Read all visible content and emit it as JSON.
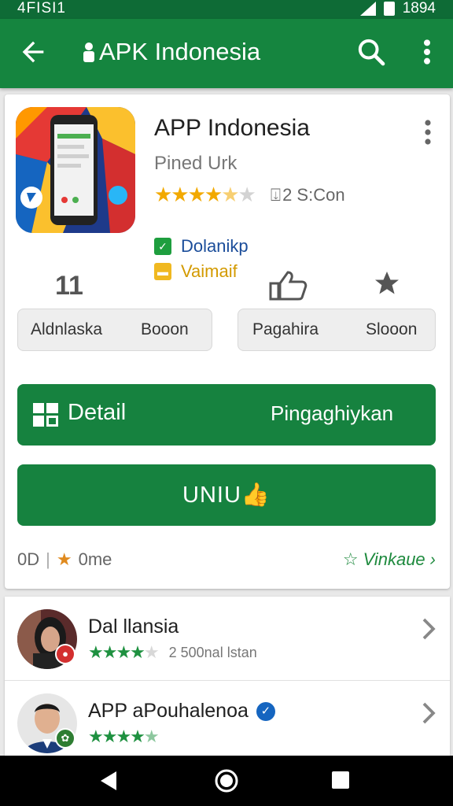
{
  "status_bar": {
    "left_text": "4FISI1",
    "time": "1894"
  },
  "app_bar": {
    "title": "APK Indonesia"
  },
  "app": {
    "name": "APP Indonesia",
    "developer": "Pined Urk",
    "rating": 4.5,
    "reviews": "2 S:Con",
    "badges": [
      {
        "label": "Dolanikp",
        "color": "#1b4d9a"
      },
      {
        "label": "Vaimaif",
        "color": "#d39a00"
      }
    ],
    "stat_left_icon_text": "11",
    "stat_left": {
      "label": "Aldnlaska",
      "value": "Booon"
    },
    "stat_right": {
      "label": "Pagahira",
      "value": "Slooon"
    }
  },
  "buttons": {
    "detail_label": "Detail",
    "detail_secondary": "Pingaghiykan",
    "install_label": "UNIU"
  },
  "footer": {
    "left_code": "0D",
    "left_text": "0me",
    "right_text": "Vinkaue"
  },
  "list": [
    {
      "name": "Dal llansia",
      "rating": 4,
      "rating_text": "2 500nal lstan",
      "badge_color": "#d32f2f",
      "verified": false
    },
    {
      "name": "APP aPouhalenoa",
      "rating": 4.5,
      "rating_text": "",
      "badge_color": "#2e7d32",
      "verified": true
    }
  ],
  "colors": {
    "primary": "#15853f",
    "star": "#f2a900",
    "accent_green": "#1e9140"
  },
  "icons": [
    "back-arrow-icon",
    "search-icon",
    "more-vert-icon",
    "thumbs-up-icon",
    "star-icon",
    "grid-icon",
    "chevron-right-icon",
    "verified-icon",
    "nav-back-icon",
    "nav-home-icon",
    "nav-recent-icon"
  ]
}
